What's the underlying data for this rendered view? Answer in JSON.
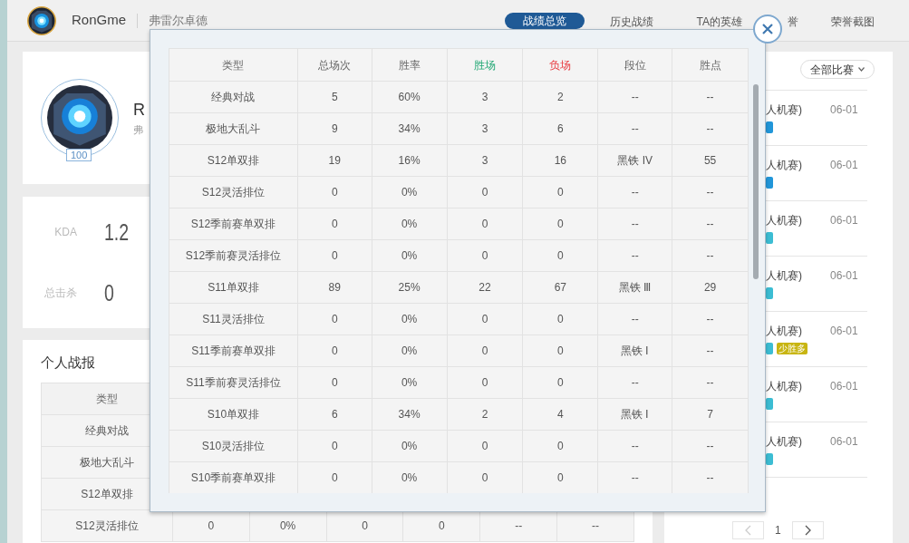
{
  "header": {
    "name": "RonGme",
    "server": "弗雷尔卓德",
    "nav": [
      {
        "label": "战绩总览",
        "selected": true
      },
      {
        "label": "历史战绩",
        "selected": false
      },
      {
        "label": "TA的英雄",
        "selected": false
      },
      {
        "label": "誉",
        "selected": false
      },
      {
        "label": "荣誉截图",
        "selected": false
      }
    ]
  },
  "profile": {
    "name": "R",
    "server": "弗",
    "level": "100"
  },
  "stats": [
    {
      "label": "KDA",
      "value": "1.2"
    },
    {
      "label": "总击杀",
      "value": "0"
    }
  ],
  "report": {
    "title": "个人战报",
    "header": "类型",
    "rows": [
      [
        "经典对战"
      ],
      [
        "极地大乱斗"
      ],
      [
        "S12单双排"
      ],
      [
        "S12灵活排位",
        "0",
        "0%",
        "0",
        "0",
        "--",
        "--"
      ]
    ]
  },
  "matches": {
    "filter": "全部比赛",
    "items": [
      {
        "mode": "人机赛)",
        "date": "06-01",
        "tags": [
          {
            "color": "#2196d9"
          }
        ]
      },
      {
        "mode": "人机赛)",
        "date": "06-01",
        "tags": [
          {
            "color": "#2196d9"
          }
        ]
      },
      {
        "mode": "人机赛)",
        "date": "06-01",
        "tags": [
          {
            "color": "#3cbdd3"
          }
        ]
      },
      {
        "mode": "人机赛)",
        "date": "06-01",
        "tags": [
          {
            "color": "#3cbdd3"
          }
        ]
      },
      {
        "mode": "人机赛)",
        "date": "06-01",
        "tags": [
          {
            "color": "#3cbdd3"
          },
          {
            "label": "少胜多",
            "color": "#c8b512"
          }
        ]
      },
      {
        "mode": "人机赛)",
        "date": "06-01",
        "tags": [
          {
            "color": "#3cbdd3"
          }
        ]
      },
      {
        "mode": "人机赛)",
        "date": "06-01",
        "tags": [
          {
            "color": "#3cbdd3"
          }
        ]
      }
    ],
    "page": "1"
  },
  "modal": {
    "columns": [
      {
        "label": "类型",
        "kind": "plain"
      },
      {
        "label": "总场次",
        "kind": "plain"
      },
      {
        "label": "胜率",
        "kind": "plain"
      },
      {
        "label": "胜场",
        "kind": "win"
      },
      {
        "label": "负场",
        "kind": "loss"
      },
      {
        "label": "段位",
        "kind": "plain"
      },
      {
        "label": "胜点",
        "kind": "plain"
      }
    ],
    "rows": [
      [
        "经典对战",
        "5",
        "60%",
        "3",
        "2",
        "--",
        "--"
      ],
      [
        "极地大乱斗",
        "9",
        "34%",
        "3",
        "6",
        "--",
        "--"
      ],
      [
        "S12单双排",
        "19",
        "16%",
        "3",
        "16",
        "黑铁 IV",
        "55"
      ],
      [
        "S12灵活排位",
        "0",
        "0%",
        "0",
        "0",
        "--",
        "--"
      ],
      [
        "S12季前赛单双排",
        "0",
        "0%",
        "0",
        "0",
        "--",
        "--"
      ],
      [
        "S12季前赛灵活排位",
        "0",
        "0%",
        "0",
        "0",
        "--",
        "--"
      ],
      [
        "S11单双排",
        "89",
        "25%",
        "22",
        "67",
        "黑铁 Ⅲ",
        "29"
      ],
      [
        "S11灵活排位",
        "0",
        "0%",
        "0",
        "0",
        "--",
        "--"
      ],
      [
        "S11季前赛单双排",
        "0",
        "0%",
        "0",
        "0",
        "黑铁 Ⅰ",
        "--"
      ],
      [
        "S11季前赛灵活排位",
        "0",
        "0%",
        "0",
        "0",
        "--",
        "--"
      ],
      [
        "S10单双排",
        "6",
        "34%",
        "2",
        "4",
        "黑铁 Ⅰ",
        "7"
      ],
      [
        "S10灵活排位",
        "0",
        "0%",
        "0",
        "0",
        "--",
        "--"
      ],
      [
        "S10季前赛单双排",
        "0",
        "0%",
        "0",
        "0",
        "--",
        "--"
      ]
    ]
  }
}
